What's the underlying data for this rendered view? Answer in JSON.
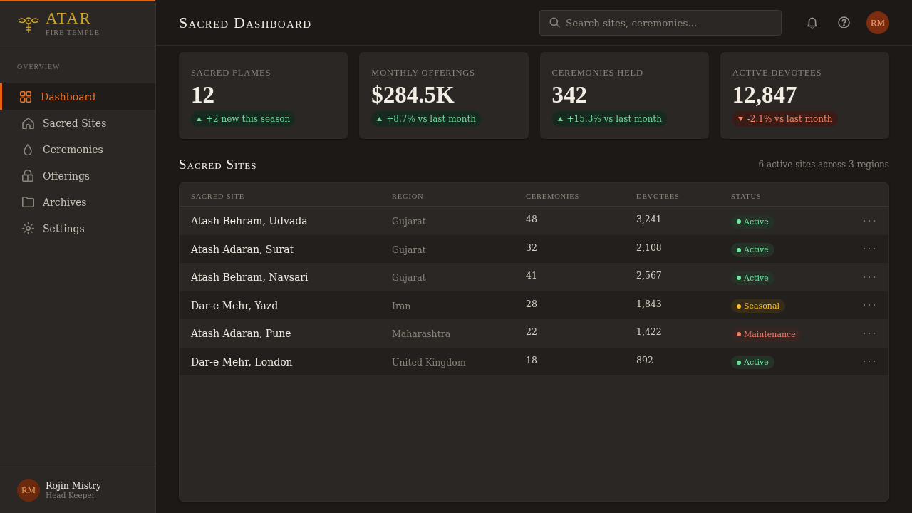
{
  "sidebar": {
    "brand": {
      "name": "ATAR",
      "tagline": "FIRE TEMPLE"
    },
    "section_label": "OVERVIEW",
    "nav": [
      {
        "label": "Dashboard",
        "selected": true
      },
      {
        "label": "Sacred Sites",
        "selected": false
      },
      {
        "label": "Ceremonies",
        "selected": false
      },
      {
        "label": "Offerings",
        "selected": false
      },
      {
        "label": "Archives",
        "selected": false
      },
      {
        "label": "Settings",
        "selected": false
      }
    ],
    "user": {
      "initials": "RM",
      "name": "Rojin Mistry",
      "role": "Head Keeper"
    }
  },
  "header": {
    "title": "Sacred Dashboard",
    "search": {
      "placeholder": "Search sites, ceremonies..."
    },
    "avatar": "RM"
  },
  "stats": [
    {
      "label": "SACRED FLAMES",
      "value": "12",
      "trend": {
        "kind": "up",
        "text": "+2 new this season"
      }
    },
    {
      "label": "MONTHLY OFFERINGS",
      "value": "$284.5K",
      "trend": {
        "kind": "up",
        "text": "+8.7% vs last month"
      }
    },
    {
      "label": "CEREMONIES HELD",
      "value": "342",
      "trend": {
        "kind": "up",
        "text": "+15.3% vs last month"
      }
    },
    {
      "label": "ACTIVE DEVOTEES",
      "value": "12,847",
      "trend": {
        "kind": "down",
        "text": "-2.1% vs last month"
      }
    }
  ],
  "sites": {
    "title": "Sacred Sites",
    "summary": "6 active sites across 3 regions",
    "columns": [
      "SACRED SITE",
      "REGION",
      "CEREMONIES",
      "DEVOTEES",
      "STATUS"
    ],
    "rows": [
      {
        "site": "Atash Behram, Udvada",
        "region": "Gujarat",
        "ceremonies": "48",
        "devotees": "3,241",
        "status": {
          "label": "Active",
          "color": "#6ee7a0"
        }
      },
      {
        "site": "Atash Adaran, Surat",
        "region": "Gujarat",
        "ceremonies": "32",
        "devotees": "2,108",
        "status": {
          "label": "Active",
          "color": "#6ee7a0"
        }
      },
      {
        "site": "Atash Behram, Navsari",
        "region": "Gujarat",
        "ceremonies": "41",
        "devotees": "2,567",
        "status": {
          "label": "Active",
          "color": "#6ee7a0"
        }
      },
      {
        "site": "Dar-e Mehr, Yazd",
        "region": "Iran",
        "ceremonies": "28",
        "devotees": "1,843",
        "status": {
          "label": "Seasonal",
          "color": "#fbbf24"
        }
      },
      {
        "site": "Atash Adaran, Pune",
        "region": "Maharashtra",
        "ceremonies": "22",
        "devotees": "1,422",
        "status": {
          "label": "Maintenance",
          "color": "#f08068"
        }
      },
      {
        "site": "Dar-e Mehr, London",
        "region": "United Kingdom",
        "ceremonies": "18",
        "devotees": "892",
        "status": {
          "label": "Active",
          "color": "#6ee7a0"
        }
      }
    ]
  }
}
